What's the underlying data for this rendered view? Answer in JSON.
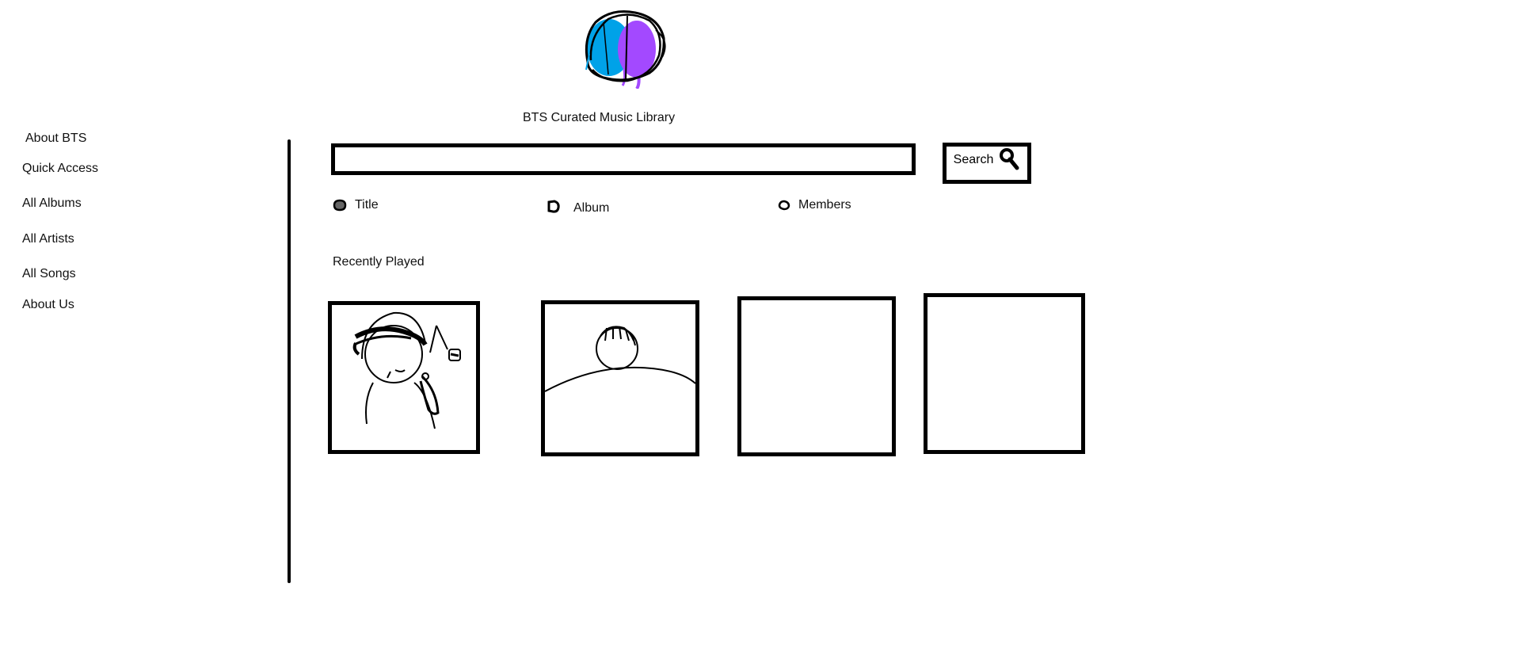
{
  "app": {
    "title": "BTS Curated Music Library",
    "logo_colors": {
      "blue": "#00a2e8",
      "purple": "#a349ff",
      "outline": "#000000"
    }
  },
  "sidebar": {
    "items": [
      {
        "label": "About BTS"
      },
      {
        "label": "Quick Access"
      },
      {
        "label": "All Albums"
      },
      {
        "label": "All Artists"
      },
      {
        "label": "All Songs"
      },
      {
        "label": "About Us"
      }
    ]
  },
  "search": {
    "value": "",
    "placeholder": "",
    "button_label": "Search",
    "button_icon": "magnifier-icon"
  },
  "filters": [
    {
      "label": "Title",
      "icon": "radio-scribble-icon"
    },
    {
      "label": "Album",
      "icon": "radio-scribble-icon"
    },
    {
      "label": "Members",
      "icon": "radio-scribble-icon"
    }
  ],
  "recently_played": {
    "title": "Recently Played",
    "cards": [
      {
        "content": "sketch-person-with-headphones"
      },
      {
        "content": "sketch-person-portrait"
      },
      {
        "content": "empty"
      },
      {
        "content": "empty"
      }
    ]
  }
}
